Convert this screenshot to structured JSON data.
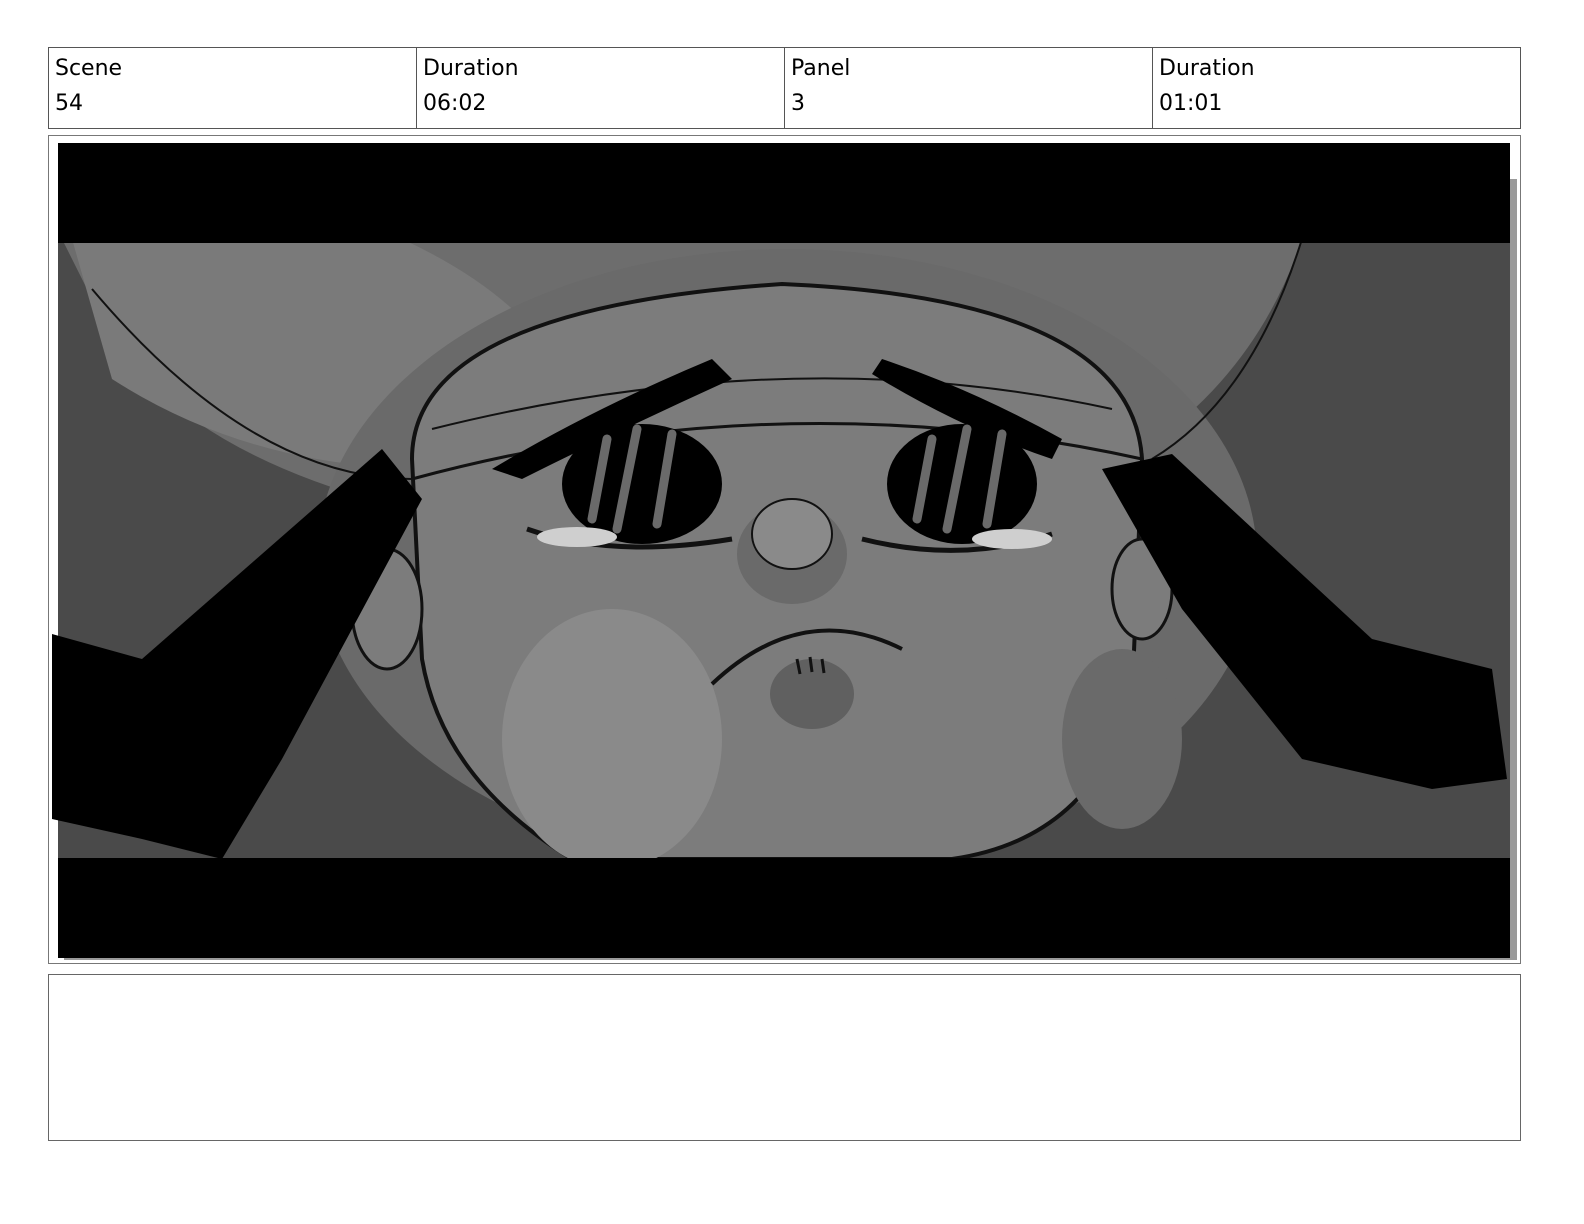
{
  "header": {
    "scene_label": "Scene",
    "scene_value": "54",
    "scene_duration_label": "Duration",
    "scene_duration_value": "06:02",
    "panel_label": "Panel",
    "panel_value": "3",
    "panel_duration_label": "Duration",
    "panel_duration_value": "01:01"
  },
  "notes": {
    "text": ""
  }
}
